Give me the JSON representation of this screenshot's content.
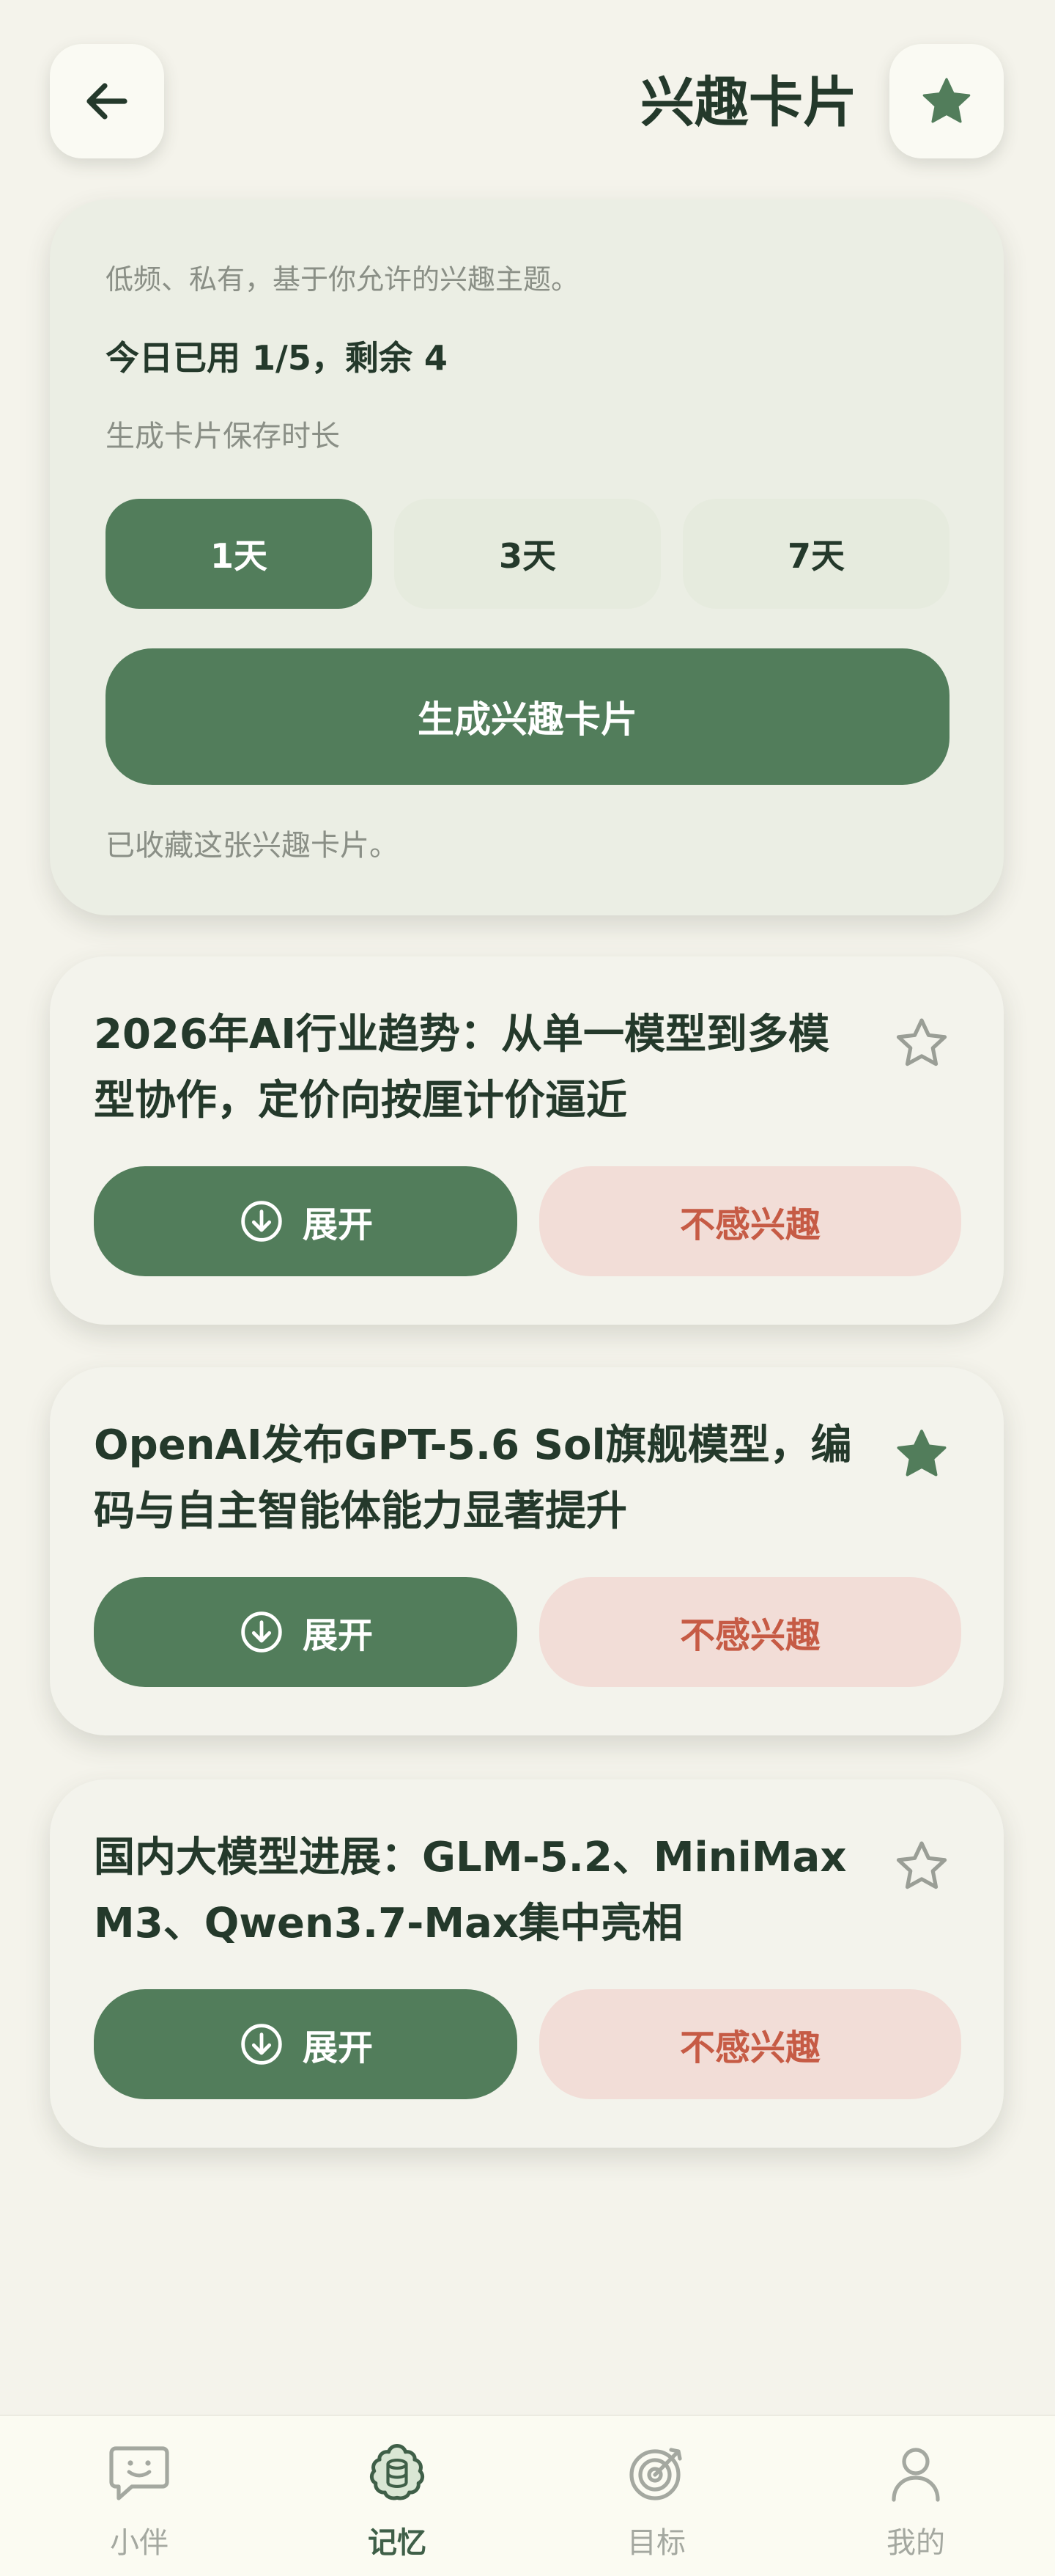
{
  "header": {
    "title": "兴趣卡片",
    "back_icon": "arrow-left-icon",
    "favorite_icon": "star-filled-icon"
  },
  "settings": {
    "intro": "低频、私有，基于你允许的兴趣主题。",
    "usage": "今日已用 1/5，剩余 4",
    "duration_label": "生成卡片保存时长",
    "durations": [
      {
        "label": "1天",
        "selected": true
      },
      {
        "label": "3天",
        "selected": false
      },
      {
        "label": "7天",
        "selected": false
      }
    ],
    "generate_button": "生成兴趣卡片",
    "status": "已收藏这张兴趣卡片。"
  },
  "cards": [
    {
      "title": "2026年AI行业趋势：从单一模型到多模型协作，定价向按厘计价逼近",
      "starred": false,
      "expand_label": "展开",
      "dislike_label": "不感兴趣"
    },
    {
      "title": "OpenAI发布GPT-5.6 Sol旗舰模型，编码与自主智能体能力显著提升",
      "starred": true,
      "expand_label": "展开",
      "dislike_label": "不感兴趣"
    },
    {
      "title": "国内大模型进展：GLM-5.2、MiniMax M3、Qwen3.7-Max集中亮相",
      "starred": false,
      "expand_label": "展开",
      "dislike_label": "不感兴趣"
    }
  ],
  "nav": [
    {
      "label": "小伴",
      "icon": "chat-bubble-icon",
      "active": false
    },
    {
      "label": "记忆",
      "icon": "brain-icon",
      "active": true
    },
    {
      "label": "目标",
      "icon": "target-icon",
      "active": false
    },
    {
      "label": "我的",
      "icon": "user-icon",
      "active": false
    }
  ],
  "colors": {
    "primary": "#527d5b",
    "background": "#f4f3eb",
    "dislike_bg": "#f2ddd7",
    "dislike_text": "#c65b45",
    "text": "#24392b"
  }
}
